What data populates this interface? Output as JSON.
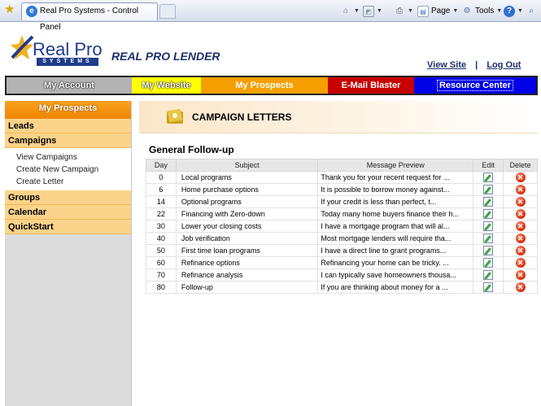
{
  "browser": {
    "tab_title": "Real Pro Systems - Control Panel",
    "commands": {
      "page": "Page",
      "tools": "Tools"
    }
  },
  "header": {
    "logo_text": "Real Pro",
    "logo_subtext": "SYSTEMS",
    "brand_title": "REAL PRO LENDER",
    "links": {
      "view_site": "View Site",
      "separator": "|",
      "log_out": "Log Out"
    }
  },
  "nav": [
    {
      "label": "My Account",
      "color": "#b3b3b3"
    },
    {
      "label": "My Website",
      "color": "#ffff00"
    },
    {
      "label": "My Prospects",
      "color": "#f5a000"
    },
    {
      "label": "E-Mail Blaster",
      "color": "#c80000"
    },
    {
      "label": "Resource Center",
      "color": "#0000e6"
    }
  ],
  "sidebar": {
    "heading": "My Prospects",
    "sections": {
      "leads": "Leads",
      "campaigns": "Campaigns",
      "groups": "Groups",
      "calendar": "Calendar",
      "quickstart": "QuickStart"
    },
    "campaign_links": [
      "View Campaigns",
      "Create New Campaign",
      "Create Letter"
    ]
  },
  "main": {
    "page_title": "CAMPAIGN LETTERS",
    "section_title": "General Follow-up",
    "columns": [
      "Day",
      "Subject",
      "Message Preview",
      "Edit",
      "Delete"
    ],
    "rows": [
      {
        "day": "0",
        "subject": "Local programs",
        "preview": "Thank you for your recent request for ..."
      },
      {
        "day": "6",
        "subject": "Home purchase options",
        "preview": "It is possible to borrow money against..."
      },
      {
        "day": "14",
        "subject": "Optional programs",
        "preview": "If your credit is less than perfect, t..."
      },
      {
        "day": "22",
        "subject": "Financing with Zero-down",
        "preview": "Today many home buyers finance their h..."
      },
      {
        "day": "30",
        "subject": "Lower your closing costs",
        "preview": "I have a mortgage program that will al..."
      },
      {
        "day": "40",
        "subject": "Job verification",
        "preview": "Most mortgage lenders will require tha..."
      },
      {
        "day": "50",
        "subject": "First time loan programs",
        "preview": "I have a direct line to grant programs..."
      },
      {
        "day": "60",
        "subject": "Refinance options",
        "preview": "Refinancing your home can be tricky. ..."
      },
      {
        "day": "70",
        "subject": "Refinance analysis",
        "preview": "I can typically save homeowners thousa..."
      },
      {
        "day": "80",
        "subject": "Follow-up",
        "preview": "If you are thinking about money for a ..."
      }
    ]
  },
  "icons": {
    "favorites": "star-icon",
    "home": "home-icon",
    "feeds": "feeds-icon",
    "print": "print-icon",
    "page": "page-icon",
    "tools": "tools-icon",
    "help": "help-icon",
    "research": "research-icon",
    "edit": "edit-icon",
    "delete": "delete-icon"
  }
}
